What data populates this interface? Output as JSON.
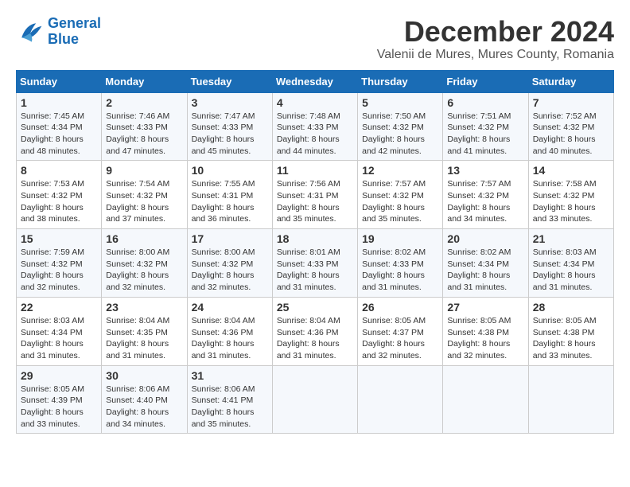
{
  "header": {
    "logo_line1": "General",
    "logo_line2": "Blue",
    "month": "December 2024",
    "location": "Valenii de Mures, Mures County, Romania"
  },
  "weekdays": [
    "Sunday",
    "Monday",
    "Tuesday",
    "Wednesday",
    "Thursday",
    "Friday",
    "Saturday"
  ],
  "weeks": [
    [
      {
        "day": 1,
        "sunrise": "7:45 AM",
        "sunset": "4:34 PM",
        "daylight": "8 hours and 48 minutes."
      },
      {
        "day": 2,
        "sunrise": "7:46 AM",
        "sunset": "4:33 PM",
        "daylight": "8 hours and 47 minutes."
      },
      {
        "day": 3,
        "sunrise": "7:47 AM",
        "sunset": "4:33 PM",
        "daylight": "8 hours and 45 minutes."
      },
      {
        "day": 4,
        "sunrise": "7:48 AM",
        "sunset": "4:33 PM",
        "daylight": "8 hours and 44 minutes."
      },
      {
        "day": 5,
        "sunrise": "7:50 AM",
        "sunset": "4:32 PM",
        "daylight": "8 hours and 42 minutes."
      },
      {
        "day": 6,
        "sunrise": "7:51 AM",
        "sunset": "4:32 PM",
        "daylight": "8 hours and 41 minutes."
      },
      {
        "day": 7,
        "sunrise": "7:52 AM",
        "sunset": "4:32 PM",
        "daylight": "8 hours and 40 minutes."
      }
    ],
    [
      {
        "day": 8,
        "sunrise": "7:53 AM",
        "sunset": "4:32 PM",
        "daylight": "8 hours and 38 minutes."
      },
      {
        "day": 9,
        "sunrise": "7:54 AM",
        "sunset": "4:32 PM",
        "daylight": "8 hours and 37 minutes."
      },
      {
        "day": 10,
        "sunrise": "7:55 AM",
        "sunset": "4:31 PM",
        "daylight": "8 hours and 36 minutes."
      },
      {
        "day": 11,
        "sunrise": "7:56 AM",
        "sunset": "4:31 PM",
        "daylight": "8 hours and 35 minutes."
      },
      {
        "day": 12,
        "sunrise": "7:57 AM",
        "sunset": "4:32 PM",
        "daylight": "8 hours and 35 minutes."
      },
      {
        "day": 13,
        "sunrise": "7:57 AM",
        "sunset": "4:32 PM",
        "daylight": "8 hours and 34 minutes."
      },
      {
        "day": 14,
        "sunrise": "7:58 AM",
        "sunset": "4:32 PM",
        "daylight": "8 hours and 33 minutes."
      }
    ],
    [
      {
        "day": 15,
        "sunrise": "7:59 AM",
        "sunset": "4:32 PM",
        "daylight": "8 hours and 32 minutes."
      },
      {
        "day": 16,
        "sunrise": "8:00 AM",
        "sunset": "4:32 PM",
        "daylight": "8 hours and 32 minutes."
      },
      {
        "day": 17,
        "sunrise": "8:00 AM",
        "sunset": "4:32 PM",
        "daylight": "8 hours and 32 minutes."
      },
      {
        "day": 18,
        "sunrise": "8:01 AM",
        "sunset": "4:33 PM",
        "daylight": "8 hours and 31 minutes."
      },
      {
        "day": 19,
        "sunrise": "8:02 AM",
        "sunset": "4:33 PM",
        "daylight": "8 hours and 31 minutes."
      },
      {
        "day": 20,
        "sunrise": "8:02 AM",
        "sunset": "4:34 PM",
        "daylight": "8 hours and 31 minutes."
      },
      {
        "day": 21,
        "sunrise": "8:03 AM",
        "sunset": "4:34 PM",
        "daylight": "8 hours and 31 minutes."
      }
    ],
    [
      {
        "day": 22,
        "sunrise": "8:03 AM",
        "sunset": "4:34 PM",
        "daylight": "8 hours and 31 minutes."
      },
      {
        "day": 23,
        "sunrise": "8:04 AM",
        "sunset": "4:35 PM",
        "daylight": "8 hours and 31 minutes."
      },
      {
        "day": 24,
        "sunrise": "8:04 AM",
        "sunset": "4:36 PM",
        "daylight": "8 hours and 31 minutes."
      },
      {
        "day": 25,
        "sunrise": "8:04 AM",
        "sunset": "4:36 PM",
        "daylight": "8 hours and 31 minutes."
      },
      {
        "day": 26,
        "sunrise": "8:05 AM",
        "sunset": "4:37 PM",
        "daylight": "8 hours and 32 minutes."
      },
      {
        "day": 27,
        "sunrise": "8:05 AM",
        "sunset": "4:38 PM",
        "daylight": "8 hours and 32 minutes."
      },
      {
        "day": 28,
        "sunrise": "8:05 AM",
        "sunset": "4:38 PM",
        "daylight": "8 hours and 33 minutes."
      }
    ],
    [
      {
        "day": 29,
        "sunrise": "8:05 AM",
        "sunset": "4:39 PM",
        "daylight": "8 hours and 33 minutes."
      },
      {
        "day": 30,
        "sunrise": "8:06 AM",
        "sunset": "4:40 PM",
        "daylight": "8 hours and 34 minutes."
      },
      {
        "day": 31,
        "sunrise": "8:06 AM",
        "sunset": "4:41 PM",
        "daylight": "8 hours and 35 minutes."
      },
      null,
      null,
      null,
      null
    ]
  ]
}
